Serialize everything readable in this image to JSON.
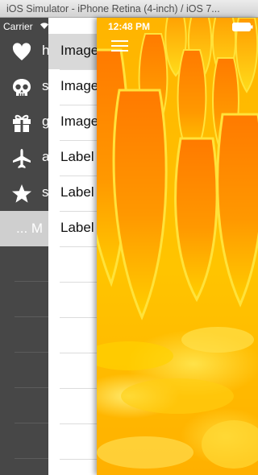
{
  "window": {
    "title": "iOS Simulator - iPhone Retina (4-inch) / iOS 7..."
  },
  "status_bar": {
    "carrier": "Carrier",
    "time": "12:48 PM"
  },
  "left_menu": {
    "items": [
      {
        "icon": "heart-icon",
        "label": "h"
      },
      {
        "icon": "skull-icon",
        "label": "s"
      },
      {
        "icon": "gift-icon",
        "label": "g"
      },
      {
        "icon": "airplane-icon",
        "label": "a"
      },
      {
        "icon": "star-icon",
        "label": "s"
      },
      {
        "icon": "",
        "label": "... M"
      }
    ],
    "selected_index": 5
  },
  "middle_list": {
    "items": [
      {
        "label": "Image"
      },
      {
        "label": "Image"
      },
      {
        "label": "Image"
      },
      {
        "label": "Label"
      },
      {
        "label": "Label"
      },
      {
        "label": "Label"
      }
    ],
    "selected_index": 0
  },
  "colors": {
    "menu_bg": "#474747",
    "selected_row": "#cfcfcf",
    "photo_accent": "#ffb400"
  }
}
